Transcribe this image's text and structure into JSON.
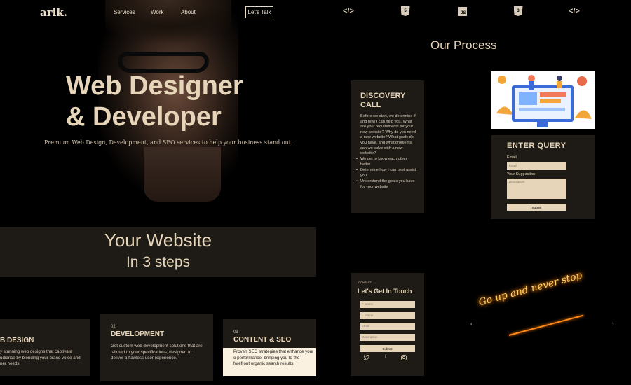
{
  "header": {
    "logo": "arik.",
    "nav": [
      "Services",
      "Work",
      "About"
    ],
    "cta": "Let's Talk"
  },
  "hero": {
    "title_line1": "Web Designer",
    "title_line2": "& Developer",
    "subtitle": "Premium Web Design, Development, and SEO services to help your business stand out."
  },
  "steps_band": {
    "line1": "Your Website",
    "line2": "In 3 steps"
  },
  "steps": [
    {
      "num": "",
      "title": "B DESIGN",
      "text": "y stunning web designs that captivate udience by blending your brand voice and ner needs"
    },
    {
      "num": "02",
      "title": "DEVELOPMENT",
      "text": "Get custom web development solutions that are tailored to your specifications, designed to deliver a flawless user experience."
    },
    {
      "num": "03",
      "title": "CONTENT & SEO",
      "text": "Proven SEO strategies that enhance your o performance, bringing you to the forefront organic search results."
    }
  ],
  "tech_icons": [
    "code-icon",
    "html5-icon",
    "js-icon",
    "css3-icon",
    "code-icon"
  ],
  "process": {
    "title": "Our Process",
    "discovery_title_1": "DISCOVERY",
    "discovery_title_2": "CALL",
    "discovery_body": "Before we start, we determine if and how I can help you. What are your requirements for your new website? Why do you need a new website? What goals do you have, and what problems can we solve with a new website?",
    "discovery_points": [
      "We get to know each other better",
      "Determine how I can best assist you",
      "Understand the goals you have for your website"
    ]
  },
  "query": {
    "title": "ENTER QUERY",
    "email_label": "Email",
    "email_placeholder": "Email",
    "suggestion_label": "Your Suggestion",
    "suggestion_placeholder": "Description",
    "submit": "Submit"
  },
  "contact": {
    "small": "CONTACT",
    "title": "Let's Get In Touch",
    "fields": [
      "F. name",
      "L. name",
      "Email",
      "Description"
    ],
    "submit": "Submit"
  },
  "slider": {
    "caption": "Go up and never stop",
    "prev": "‹",
    "next": "›"
  },
  "colors": {
    "accent": "#e6d5b8",
    "panel": "#1e1b17",
    "background": "#000000",
    "neon": "#ffcf6a"
  }
}
